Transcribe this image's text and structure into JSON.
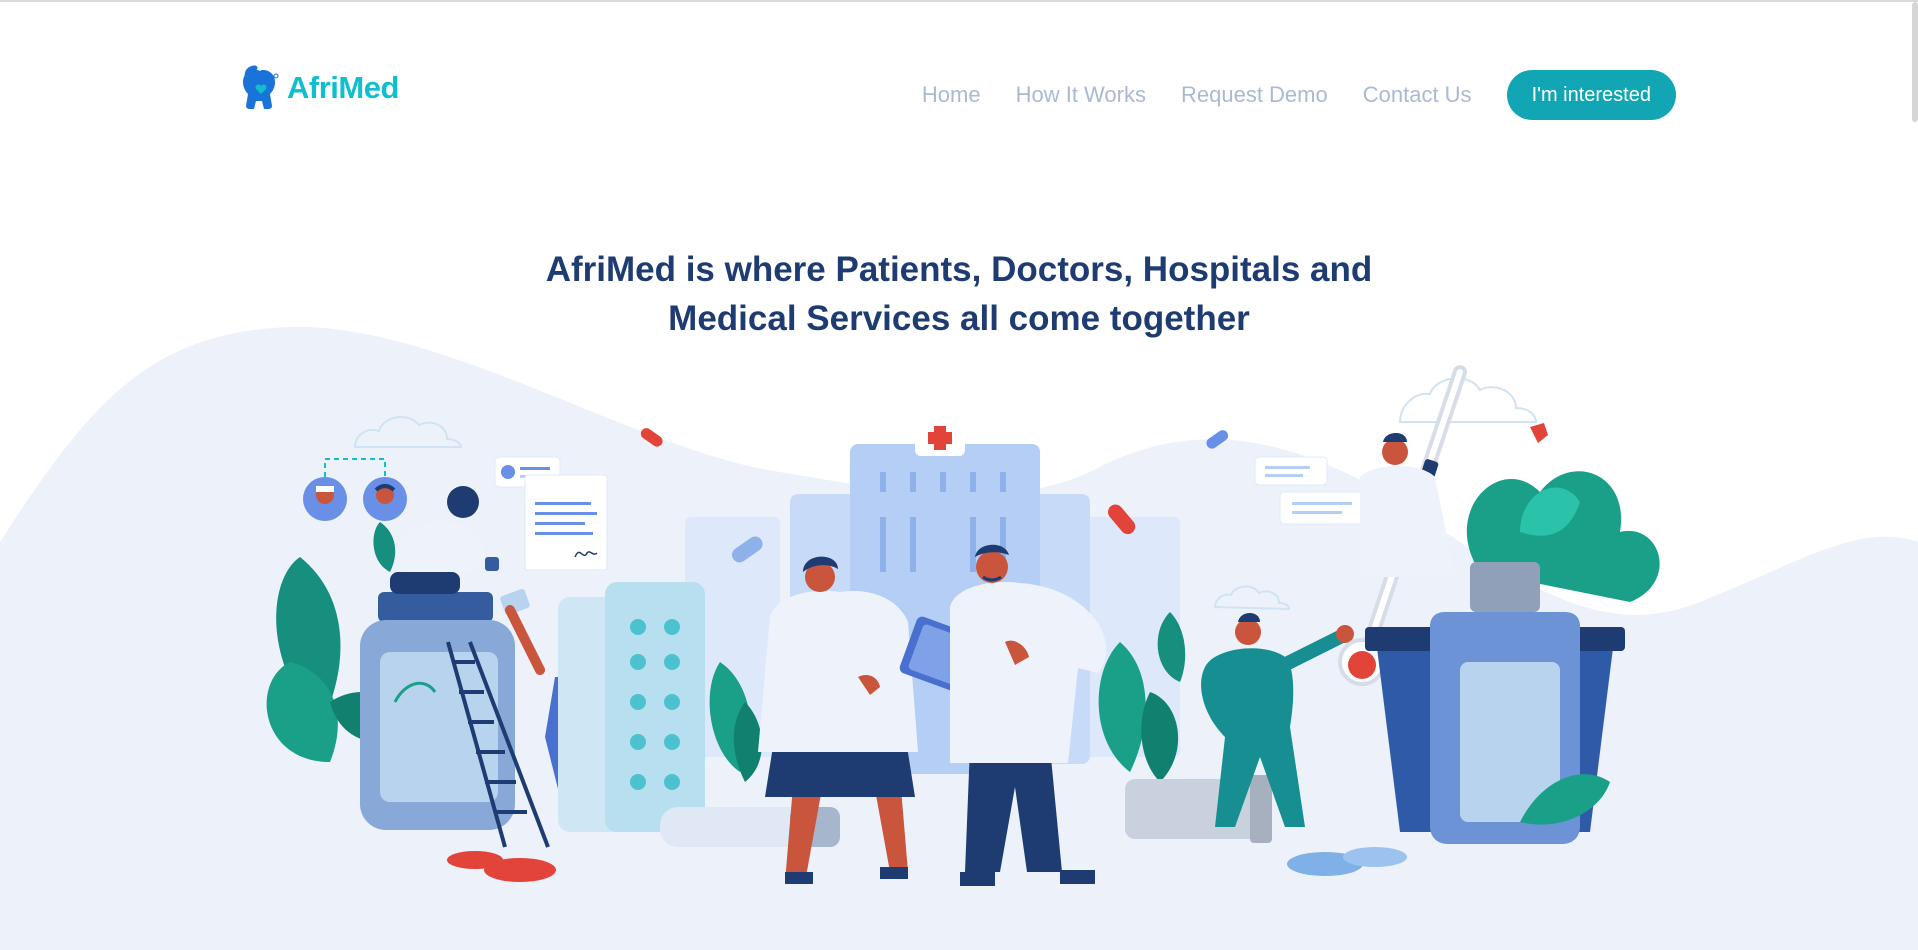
{
  "brand": {
    "name": "AfriMed"
  },
  "nav": {
    "links": [
      "Home",
      "How It Works",
      "Request Demo",
      "Contact Us"
    ],
    "cta_label": "I'm interested"
  },
  "hero": {
    "title_lines": [
      "AfriMed is where Patients, Doctors, Hospitals and",
      "Medical Services all come together"
    ]
  },
  "illustration": {
    "subject": "doctors-patients-hospital-medicine-illustration"
  },
  "colors": {
    "brand": "#10bfcf",
    "button": "#12a5b4",
    "title": "#1f3c72",
    "nav": "#a9b9d4",
    "wave": "#edf2fa"
  }
}
